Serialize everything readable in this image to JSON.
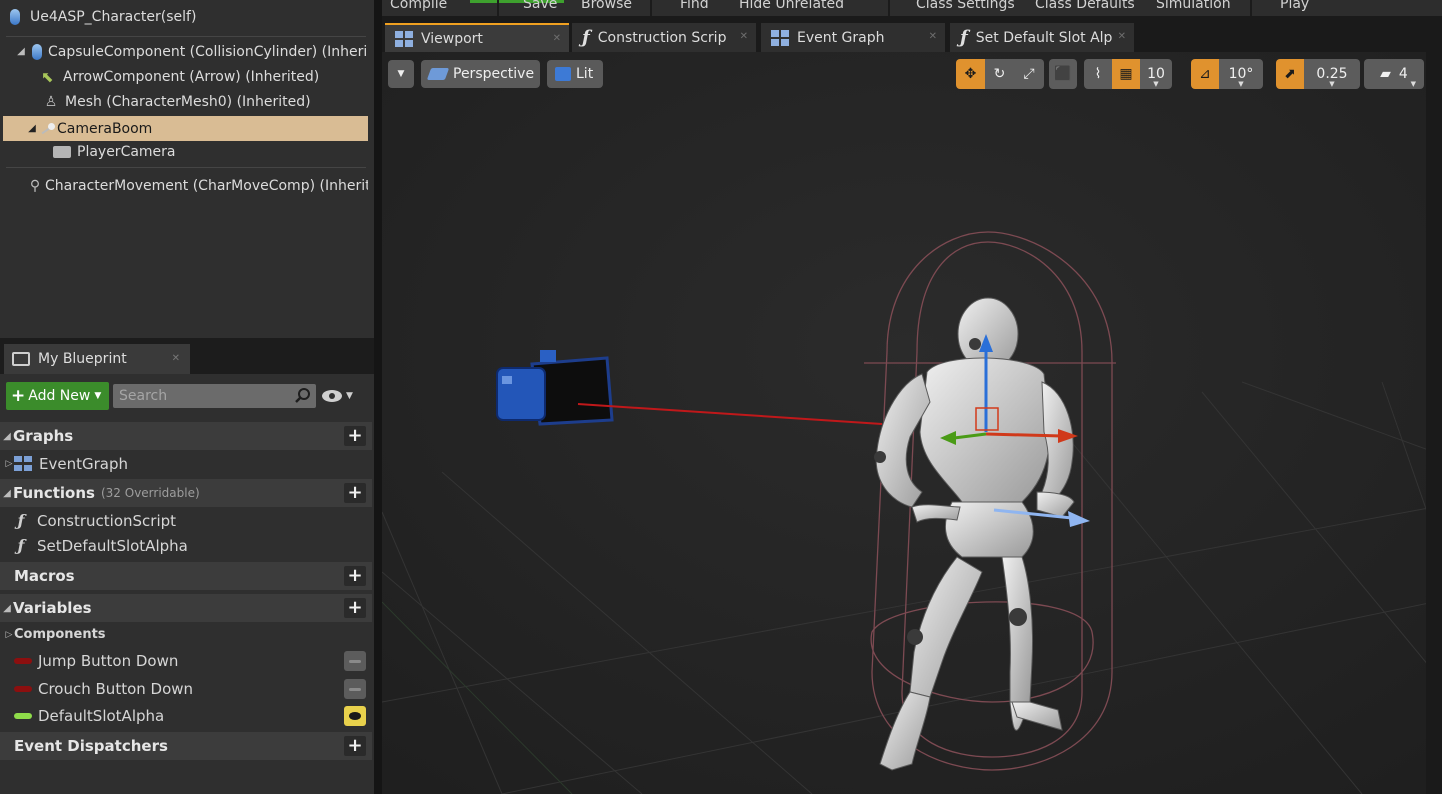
{
  "components": {
    "root_label": "Ue4ASP_Character(self)",
    "items": [
      {
        "label": "CapsuleComponent (CollisionCylinder) (Inheri"
      },
      {
        "label": "ArrowComponent (Arrow) (Inherited)"
      },
      {
        "label": "Mesh (CharacterMesh0) (Inherited)"
      },
      {
        "label": "CameraBoom"
      },
      {
        "label": "PlayerCamera"
      },
      {
        "label": "CharacterMovement (CharMoveComp) (Inherit"
      }
    ]
  },
  "my_blueprint": {
    "tab_label": "My Blueprint",
    "add_new_label": "Add New",
    "search_placeholder": "Search",
    "sections": {
      "graphs": {
        "title": "Graphs",
        "items": [
          "EventGraph"
        ]
      },
      "functions": {
        "title": "Functions",
        "subtitle": "(32 Overridable)",
        "items": [
          "ConstructionScript",
          "SetDefaultSlotAlpha"
        ]
      },
      "macros": {
        "title": "Macros"
      },
      "variables": {
        "title": "Variables",
        "category": "Components",
        "items": [
          {
            "label": "Jump Button Down",
            "type_color": "#8c0f0f",
            "visible": false
          },
          {
            "label": "Crouch Button Down",
            "type_color": "#8c0f0f",
            "visible": false
          },
          {
            "label": "DefaultSlotAlpha",
            "type_color": "#8fdc4a",
            "visible": true
          }
        ]
      },
      "event_dispatchers": {
        "title": "Event Dispatchers"
      }
    }
  },
  "toolbar": {
    "compile": "Compile",
    "save": "Save",
    "browse": "Browse",
    "find": "Find",
    "hide_unrelated": "Hide Unrelated",
    "class_settings": "Class Settings",
    "class_defaults": "Class Defaults",
    "simulation": "Simulation",
    "play": "Play"
  },
  "doc_tabs": [
    {
      "label": "Viewport",
      "active": true
    },
    {
      "label": "Construction Scrip",
      "active": false
    },
    {
      "label": "Event Graph",
      "active": false
    },
    {
      "label": "Set Default Slot Alp",
      "active": false
    }
  ],
  "viewport": {
    "perspective_label": "Perspective",
    "lit_label": "Lit",
    "grid_snap": "10",
    "rotation_snap": "10°",
    "scale_snap": "0.25",
    "camera_speed": "4"
  },
  "colors": {
    "selection": "#d9bc94",
    "accent_orange": "#e0922e",
    "add_green": "#3b8c2b"
  }
}
